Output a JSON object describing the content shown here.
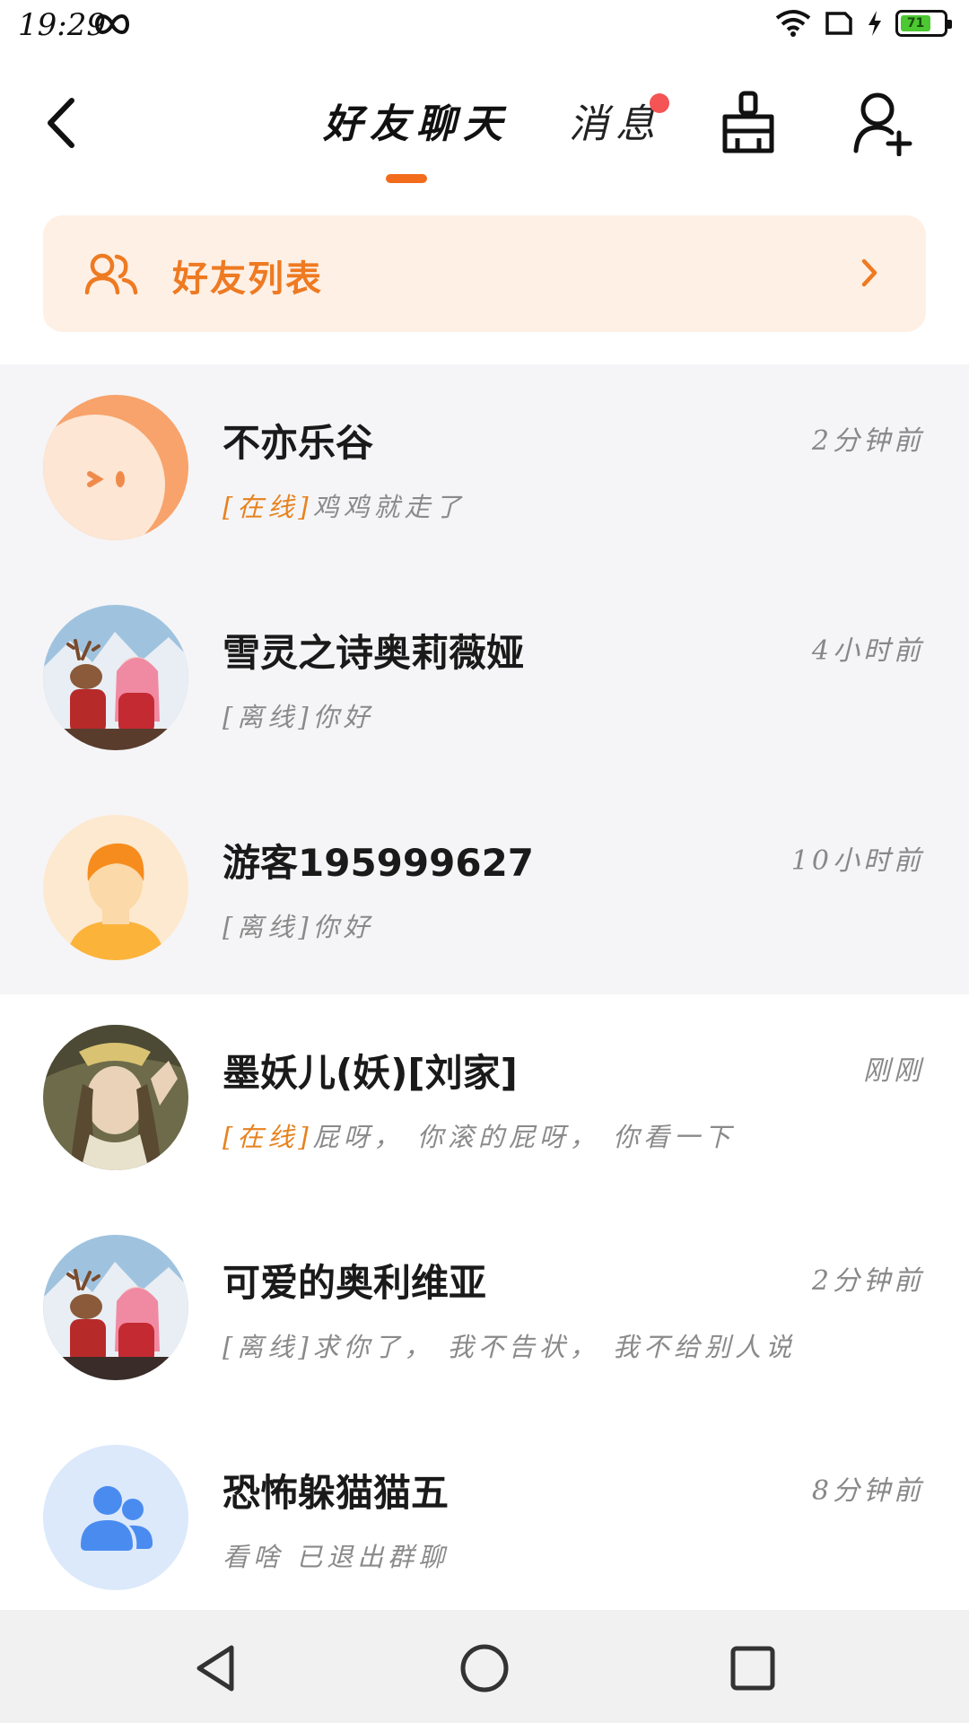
{
  "status_bar": {
    "time": "19:29",
    "battery_level": "71",
    "icons": [
      "infinity-icon",
      "wifi-icon",
      "sim-card-icon",
      "charging-bolt-icon",
      "battery-icon"
    ]
  },
  "header": {
    "tabs": [
      {
        "label": "好友聊天",
        "active": true
      },
      {
        "label": "消息",
        "active": false,
        "has_notification_dot": true
      }
    ],
    "icons": [
      "back-icon",
      "broom-clean-icon",
      "add-friend-icon"
    ]
  },
  "friend_list_banner": {
    "label": "好友列表",
    "icon": "users-icon",
    "accent_color": "#ee7a22"
  },
  "conversations": [
    {
      "name": "不亦乐谷",
      "time": "2分钟前",
      "status": "[在线]",
      "message": "鸡鸡就走了",
      "online": true
    },
    {
      "name": "雪灵之诗奥莉薇娅",
      "time": "4小时前",
      "status": "[离线]",
      "message": "你好",
      "online": false
    },
    {
      "name": "游客195999627",
      "time": "10小时前",
      "status": "[离线]",
      "message": "你好",
      "online": false
    },
    {
      "name": "墨妖儿(妖)[刘家]",
      "time": "刚刚",
      "status": "[在线]",
      "message": "屁呀， 你滚的屁呀， 你看一下",
      "online": true
    },
    {
      "name": "可爱的奥利维亚",
      "time": "2分钟前",
      "status": "[离线]",
      "message": "求你了， 我不告状， 我不给别人说",
      "online": false
    },
    {
      "name": "恐怖躲猫猫五",
      "time": "8分钟前",
      "status": "",
      "message": "看啥 已退出群聊",
      "online": false
    }
  ],
  "bottom_nav": {
    "icons": [
      "nav-back-icon",
      "nav-home-icon",
      "nav-recents-icon"
    ]
  },
  "colors": {
    "accent_orange": "#f26c1b",
    "online_status": "#e7821f",
    "notification_dot": "#f45454",
    "group_avatar_bg": "#dbe9fb",
    "group_icon": "#4a8bf0"
  }
}
